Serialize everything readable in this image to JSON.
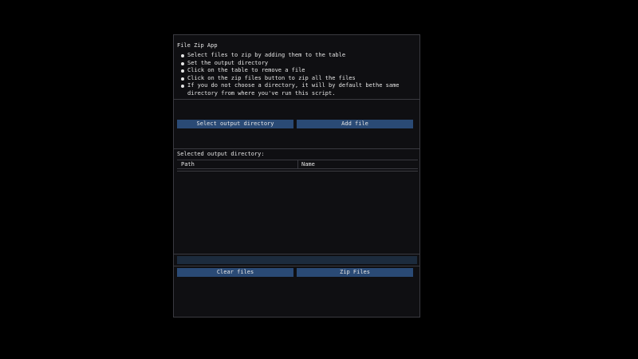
{
  "app": {
    "title": "File Zip App"
  },
  "instructions": [
    "Select files to zip by adding them to the table",
    "Set the output directory",
    "Click on the table to remove a file",
    "Click on the zip files button to zip all the files",
    "If you do not choose a directory, it will by default bethe same directory from where you've run this script."
  ],
  "buttons": {
    "select_output_directory": "Select output directory",
    "add_file": "Add file",
    "clear_files": "Clear files",
    "zip_files": "Zip Files"
  },
  "output": {
    "label": "Selected output directory:"
  },
  "table": {
    "columns": [
      "Path",
      "Name"
    ],
    "rows": []
  },
  "progress": {
    "value": 0
  },
  "colors": {
    "button": "#2a4a75",
    "window_bg": "#0f0f12",
    "page_bg": "#000000",
    "border": "#3a3a40"
  }
}
